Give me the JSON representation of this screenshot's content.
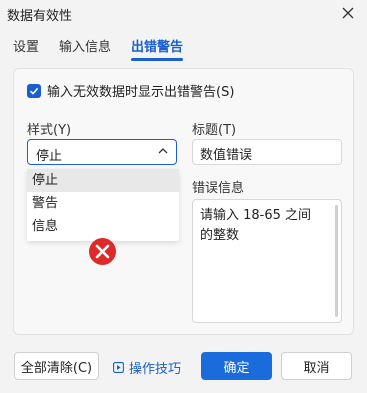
{
  "window": {
    "title": "数据有效性"
  },
  "tabs": [
    {
      "label": "设置"
    },
    {
      "label": "输入信息"
    },
    {
      "label": "出错警告"
    }
  ],
  "panel": {
    "show_error_checkbox": {
      "checked": true,
      "label": "输入无效数据时显示出错警告(S)"
    },
    "style": {
      "label": "样式(Y)",
      "value": "停止",
      "options": [
        "停止",
        "警告",
        "信息"
      ],
      "selected_index": 0,
      "icon": "error-x-icon"
    },
    "title": {
      "label": "标题(T)",
      "value": "数值错误"
    },
    "error_message": {
      "label": "错误信息",
      "line1": "请输入 18-65 之间",
      "line2": "的整数"
    }
  },
  "footer": {
    "clear_all_label": "全部清除(C)",
    "tips_label": "操作技巧",
    "ok_label": "确定",
    "cancel_label": "取消"
  },
  "colors": {
    "accent": "#1a5fd0",
    "error_red": "#e02a2a"
  }
}
